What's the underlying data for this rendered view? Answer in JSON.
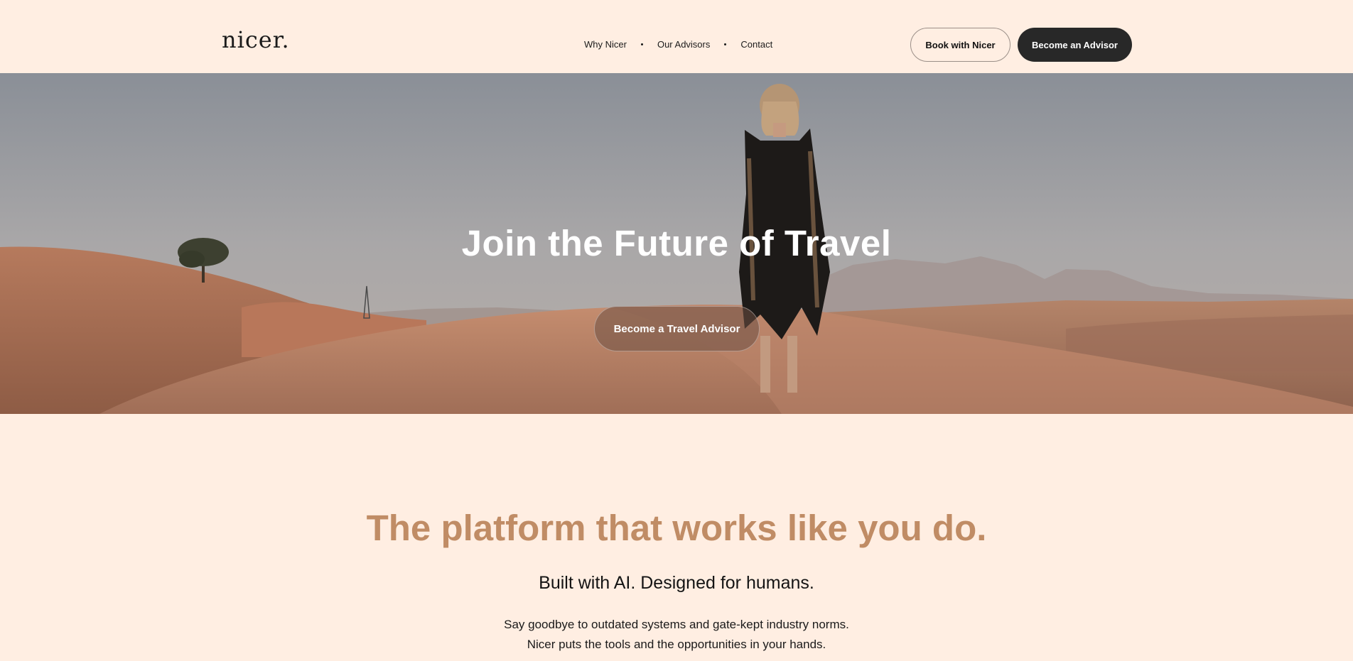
{
  "header": {
    "logo_text": "nicer.",
    "nav": [
      {
        "label": "Why Nicer"
      },
      {
        "label": "Our Advisors"
      },
      {
        "label": "Contact"
      }
    ],
    "book_button_label": "Book with Nicer",
    "advisor_button_label": "Become an Advisor"
  },
  "hero": {
    "title": "Join the Future of Travel",
    "cta_label": "Become a Travel Advisor",
    "image_description": "desert-dunes-woman-photo"
  },
  "platform": {
    "title": "The platform that works like you do.",
    "subtitle": "Built with AI. Designed for humans.",
    "body_line_1": "Say goodbye to outdated systems and gate-kept industry norms.",
    "body_line_2": "Nicer puts the tools and the opportunities in your hands."
  },
  "colors": {
    "background": "#ffeee2",
    "accent": "#c08c65",
    "dark_button": "#282828"
  }
}
